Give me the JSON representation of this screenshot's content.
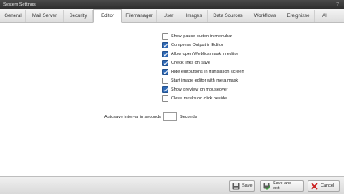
{
  "window": {
    "title": "System Settings",
    "help": "?"
  },
  "tabs": [
    {
      "label": "General"
    },
    {
      "label": "Mail Server"
    },
    {
      "label": "Security"
    },
    {
      "label": "Editor",
      "active": true
    },
    {
      "label": "Filemanager"
    },
    {
      "label": "User"
    },
    {
      "label": "Images"
    },
    {
      "label": "Data Sources"
    },
    {
      "label": "Workflows"
    },
    {
      "label": "Ereignisse"
    },
    {
      "label": "AI"
    }
  ],
  "options": [
    {
      "label": "Show pause button in menubar",
      "checked": false
    },
    {
      "label": "Compress Output in Editor",
      "checked": true
    },
    {
      "label": "Allow open Weblics mask in editor",
      "checked": true
    },
    {
      "label": "Check links on save",
      "checked": true
    },
    {
      "label": "Hide editbuttons in translation screen",
      "checked": true
    },
    {
      "label": "Start image editor with meta mask",
      "checked": false
    },
    {
      "label": "Show preview on mouseover",
      "checked": true
    },
    {
      "label": "Close masks on click beside",
      "checked": false
    }
  ],
  "autosave": {
    "label": "Autosave interval in seconds",
    "value": "",
    "unit": "Seconds"
  },
  "footer": {
    "save_label": "Save",
    "save_exit_label": "Save and exit",
    "cancel_label": "Cancel"
  },
  "colors": {
    "checkbox_checked": "#2f69b5",
    "cancel_icon": "#cc2222",
    "save_exit_icon": "#3a9a3a"
  }
}
